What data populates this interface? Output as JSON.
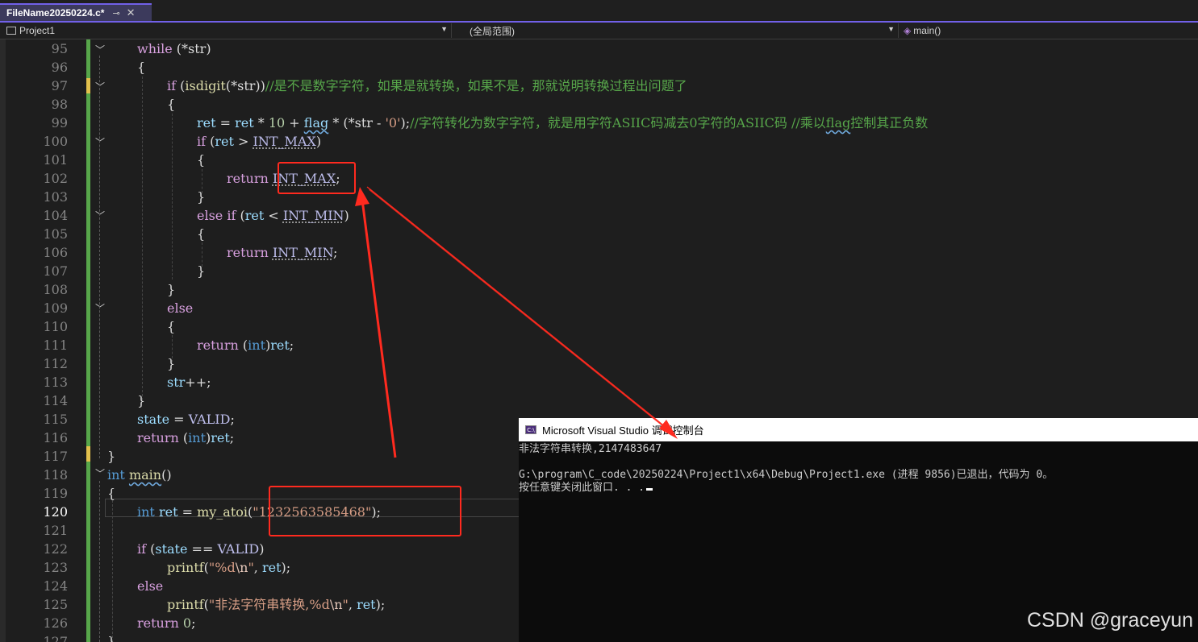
{
  "tab": {
    "title": "FileName20250224.c*",
    "pin_glyph": "⊸",
    "close_glyph": "✕"
  },
  "navbar": {
    "project": "Project1",
    "scope": "(全局范围)",
    "member": "main()"
  },
  "editor": {
    "line_numbers": [
      "95",
      "96",
      "97",
      "98",
      "99",
      "100",
      "101",
      "102",
      "103",
      "104",
      "105",
      "106",
      "107",
      "108",
      "109",
      "110",
      "111",
      "112",
      "113",
      "114",
      "115",
      "116",
      "117",
      "118",
      "119",
      "120",
      "121",
      "122",
      "123",
      "124",
      "125",
      "126",
      "127"
    ],
    "current_line": "120"
  },
  "code": {
    "l95_kw": "while",
    "l95_rest": " (*str)",
    "l96": "{",
    "l97_kw": "if",
    "l97_a": " (",
    "l97_fn": "isdigit",
    "l97_b": "(*str))",
    "l97_cmt": "//是不是数字字符，如果是就转换，如果不是，那就说明转换过程出问题了",
    "l98": "{",
    "l99_var1": "ret",
    "l99_a": " = ",
    "l99_var2": "ret",
    "l99_b": " * ",
    "l99_num": "10",
    "l99_c": " + ",
    "l99_flag": "flag",
    "l99_d": " * (*str - ",
    "l99_chr": "'0'",
    "l99_e": ");",
    "l99_cmt1": "//字符转化为数字字符，就是用字符ASIIC码减去0字符的ASIIC码 //乘以",
    "l99_cmt_flag": "flag",
    "l99_cmt2": "控制其正负数",
    "l100_kw": "if",
    "l100_a": " (",
    "l100_var": "ret",
    "l100_b": " > ",
    "l100_mac": "INT_MAX",
    "l100_c": ")",
    "l101": "{",
    "l102_kw": "return",
    "l102_mac": "INT_MAX",
    "l102_end": ";",
    "l103": "}",
    "l104_kw": "else if",
    "l104_a": " (",
    "l104_var": "ret",
    "l104_b": " < ",
    "l104_mac": "INT_MIN",
    "l104_c": ")",
    "l105": "{",
    "l106_kw": "return",
    "l106_mac": "INT_MIN",
    "l106_end": ";",
    "l107": "}",
    "l108": "}",
    "l109_kw": "else",
    "l110": "{",
    "l111_kw": "return",
    "l111_a": " (",
    "l111_type": "int",
    "l111_b": ")",
    "l111_var": "ret",
    "l111_end": ";",
    "l112": "}",
    "l113_var": "str",
    "l113_rest": "++;",
    "l114": "}",
    "l115_var": "state",
    "l115_a": " = ",
    "l115_val": "VALID",
    "l115_end": ";",
    "l116_kw": "return",
    "l116_a": " (",
    "l116_type": "int",
    "l116_b": ")",
    "l116_var": "ret",
    "l116_end": ";",
    "l117": "}",
    "l118_type": "int",
    "l118_fn": "main",
    "l118_rest": "()",
    "l119": "{",
    "l120_type": "int",
    "l120_var": "ret",
    "l120_a": " = ",
    "l120_fn": "my_atoi",
    "l120_b": "(",
    "l120_str": "\"1232563585468\"",
    "l120_c": ");",
    "l122_kw": "if",
    "l122_a": " (",
    "l122_var": "state",
    "l122_b": " == ",
    "l122_val": "VALID",
    "l122_c": ")",
    "l123_fn": "printf",
    "l123_a": "(",
    "l123_str1": "\"%d",
    "l123_esc": "\\n",
    "l123_str2": "\"",
    "l123_b": ", ",
    "l123_var": "ret",
    "l123_c": ");",
    "l124_kw": "else",
    "l125_fn": "printf",
    "l125_a": "(",
    "l125_str1": "\"非法字符串转换,%d",
    "l125_esc": "\\n",
    "l125_str2": "\"",
    "l125_b": ", ",
    "l125_var": "ret",
    "l125_c": ");",
    "l126_kw": "return",
    "l126_a": " ",
    "l126_num": "0",
    "l126_end": ";",
    "l127": "}"
  },
  "console": {
    "title": "Microsoft Visual Studio 调试控制台",
    "icon_label": "C:\\",
    "line1": "非法字符串转换,2147483647",
    "line2": "G:\\program\\C_code\\20250224\\Project1\\x64\\Debug\\Project1.exe (进程 9856)已退出，代码为 0。",
    "line3": "按任意键关闭此窗口. . ."
  },
  "watermark": "CSDN @graceyun",
  "colors": {
    "keyword": "#569cd6",
    "control": "#d8a0df",
    "function": "#dcdcaa",
    "variable": "#9cdcfe",
    "macro": "#bebeec",
    "comment": "#57a64a",
    "string": "#d69d85",
    "annotation": "#ff2a1f",
    "accent": "#7160e8"
  }
}
